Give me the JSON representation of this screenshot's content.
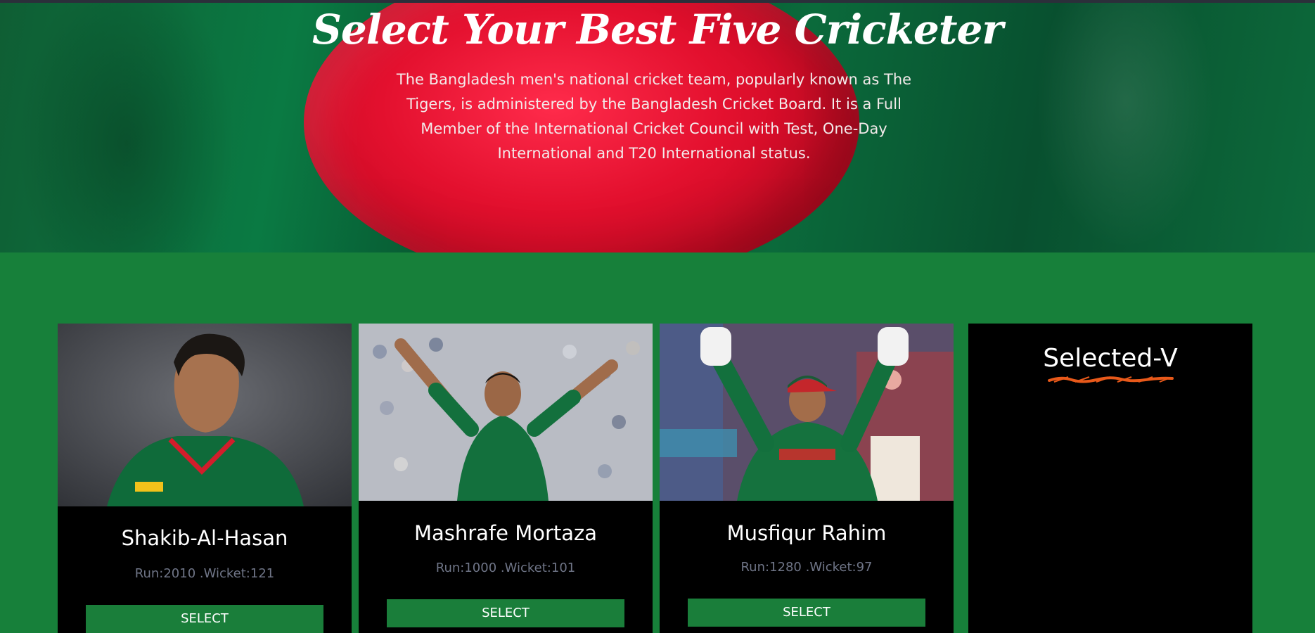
{
  "hero": {
    "title": "Select Your Best Five Cricketer",
    "description": "The Bangladesh men's national cricket team, popularly known as The Tigers, is administered by the Bangladesh Cricket Board. It is a Full Member of the International Cricket Council with Test, One-Day International and T20 International status."
  },
  "players": [
    {
      "name": "Shakib-Al-Hasan",
      "stats": "Run:2010 .Wicket:121",
      "button": "SELECT"
    },
    {
      "name": "Mashrafe Mortaza",
      "stats": "Run:1000 .Wicket:101",
      "button": "SELECT"
    },
    {
      "name": "Musfiqur Rahim",
      "stats": "Run:1280 .Wicket:97",
      "button": "SELECT"
    }
  ],
  "selected": {
    "title": "Selected-V"
  },
  "colors": {
    "page_bg": "#17803a",
    "card_bg": "#000000",
    "button_bg": "#1a7e3a",
    "flag_red": "#e3102e",
    "flag_green": "#0a6b3b",
    "underline": "#e8591a"
  }
}
